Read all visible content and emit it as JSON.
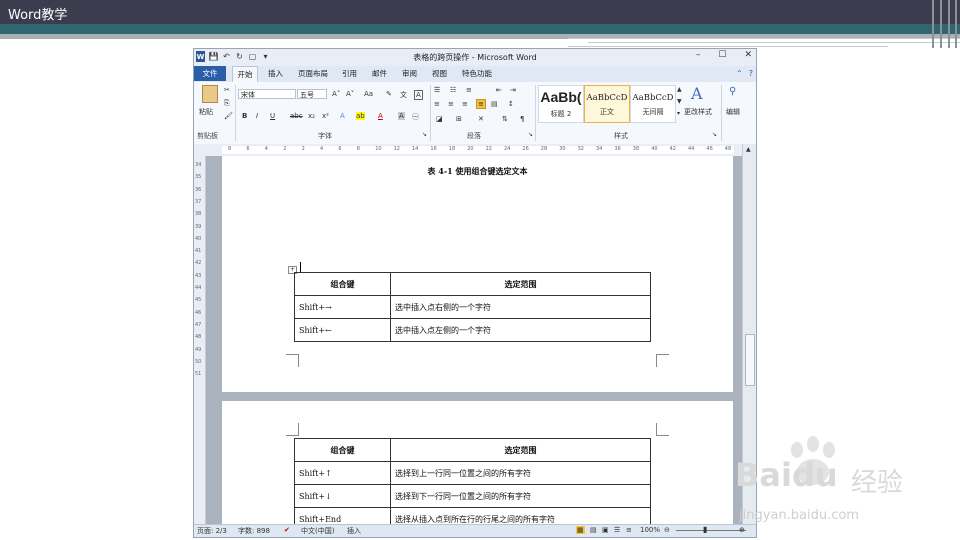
{
  "slide": {
    "title": "Word教学"
  },
  "word": {
    "window_title": "表格的跨页操作 - Microsoft Word",
    "window_controls": {
      "minimize": "–",
      "maximize": "☐",
      "close": "✕"
    },
    "qat": {
      "save": "💾",
      "undo": "↶",
      "redo": "↻",
      "new": "▢",
      "more": "▾"
    },
    "tabs": {
      "file": "文件",
      "home": "开始",
      "insert": "插入",
      "layout": "页面布局",
      "references": "引用",
      "mailings": "邮件",
      "review": "审阅",
      "view": "视图",
      "features": "特色功能"
    },
    "ribbon": {
      "paste_label": "粘贴",
      "clipboard_label": "剪贴板",
      "font_name": "宋体",
      "font_size": "五号",
      "font_group_label": "字体",
      "paragraph_group_label": "段落",
      "styles_group_label": "样式",
      "bold": "B",
      "italic": "I",
      "underline": "U",
      "strike": "abc",
      "subscript": "x₂",
      "superscript": "x²",
      "grow_font": "A˄",
      "shrink_font": "A˅",
      "change_case": "Aa",
      "font_color": "A",
      "highlight": "ab",
      "styles": [
        {
          "preview": "AaBb(",
          "name": "标题 2"
        },
        {
          "preview": "AaBbCcD",
          "name": "正文"
        },
        {
          "preview": "AaBbCcD",
          "name": "无间隔"
        }
      ],
      "change_styles": "更改样式",
      "edit": "编辑"
    },
    "ruler_numbers": [
      "8",
      "6",
      "4",
      "2",
      "2",
      "4",
      "6",
      "8",
      "10",
      "12",
      "14",
      "16",
      "18",
      "20",
      "22",
      "24",
      "26",
      "28",
      "30",
      "32",
      "34",
      "36",
      "38",
      "40",
      "42",
      "44",
      "46",
      "48"
    ],
    "vruler_numbers": [
      "34",
      "35",
      "36",
      "37",
      "38",
      "39",
      "40",
      "41",
      "42",
      "43",
      "44",
      "45",
      "46",
      "47",
      "48",
      "49",
      "50",
      "51"
    ],
    "doc": {
      "caption": "表 4-1  使用组合键选定文本",
      "table1": {
        "headers": [
          "组合键",
          "选定范围"
        ],
        "rows": [
          [
            "Shift+→",
            "选中插入点右侧的一个字符"
          ],
          [
            "Shift+←",
            "选中插入点左侧的一个字符"
          ]
        ]
      },
      "table2": {
        "headers": [
          "组合键",
          "选定范围"
        ],
        "rows": [
          [
            "Shift+↑",
            "选择到上一行同一位置之间的所有字符"
          ],
          [
            "Shift+↓",
            "选择到下一行同一位置之间的所有字符"
          ],
          [
            "Shift+End",
            "选择从插入点到所在行的行尾之间的所有字符"
          ]
        ]
      }
    },
    "status": {
      "page": "页面: 2/3",
      "words": "字数: 898",
      "language": "中文(中国)",
      "mode": "插入",
      "zoom": "100%"
    }
  },
  "watermark": {
    "brand": "Baidu",
    "suffix": "经验",
    "url": "jingyan.baidu.com"
  }
}
